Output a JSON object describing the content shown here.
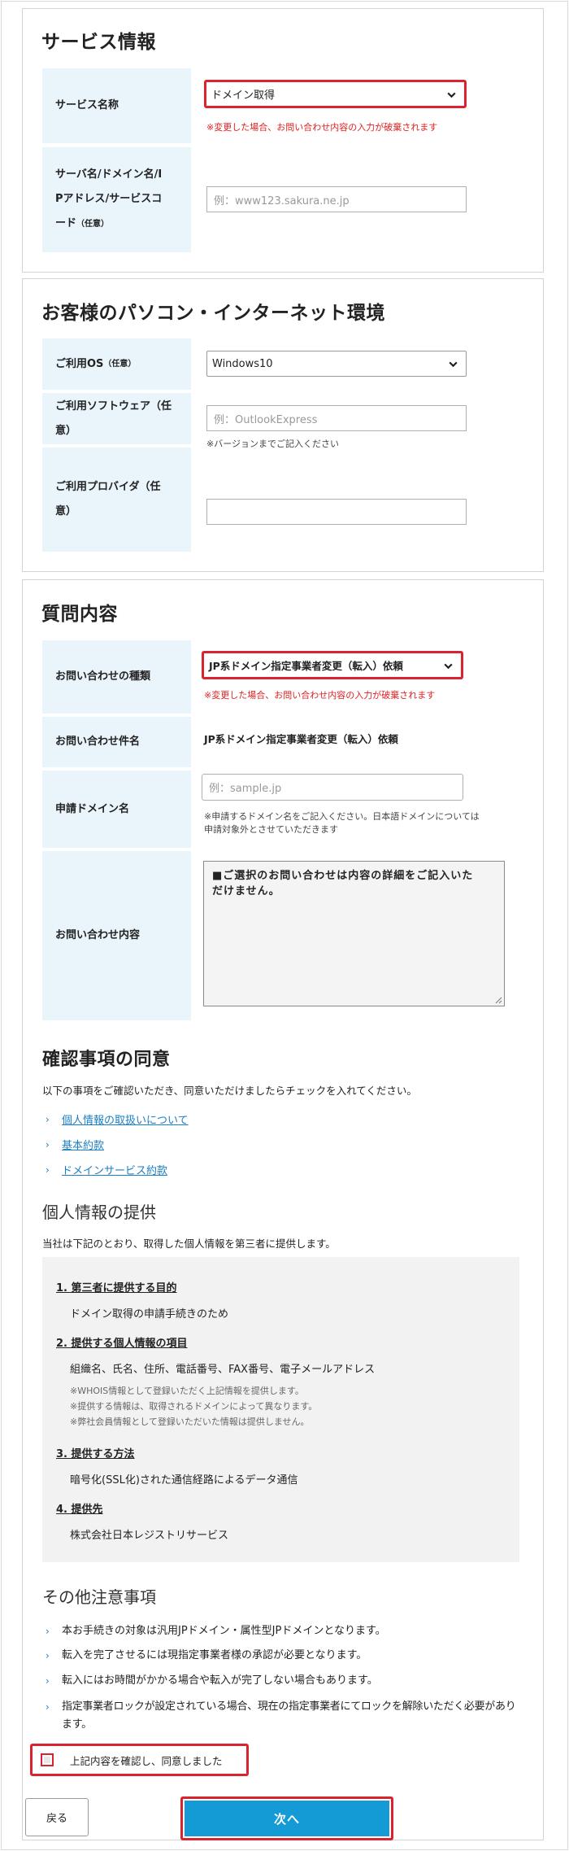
{
  "service_section": {
    "title": "サービス情報",
    "service_name_label": "サービス名称",
    "service_name_value": "ドメイン取得",
    "service_name_note": "※変更した場合、お問い合わせ内容の入力が破棄されます",
    "server_label_l1": "サーバ名/ドメイン名/I",
    "server_label_l2": "Pアドレス/サービスコ",
    "server_label_l3": "ード",
    "optional": "（任意）",
    "server_placeholder": "例：www123.sakura.ne.jp"
  },
  "env_section": {
    "title": "お客様のパソコン・インターネット環境",
    "os_label": "ご利用OS",
    "os_value": "Windows10",
    "software_label_l1": "ご利用ソフトウェア（任",
    "software_label_l2": "意）",
    "software_placeholder": "例：OutlookExpress",
    "software_note": "※バージョンまでご記入ください",
    "provider_label_l1": "ご利用プロバイダ（任",
    "provider_label_l2": "意）",
    "provider_value": ""
  },
  "inquiry_section": {
    "title": "質問内容",
    "type_label": "お問い合わせの種類",
    "type_value": "JP系ドメイン指定事業者変更（転入）依頼",
    "type_note": "※変更した場合、お問い合わせ内容の入力が破棄されます",
    "subject_label": "お問い合わせ件名",
    "subject_value": "JP系ドメイン指定事業者変更（転入）依頼",
    "domain_label": "申請ドメイン名",
    "domain_placeholder": "例：sample.jp",
    "domain_note_l1": "※申請するドメイン名をご記入ください。日本語ドメインについては",
    "domain_note_l2": "申請対象外とさせていただきます",
    "content_label": "お問い合わせ内容",
    "content_text_l1": "■ご選択のお問い合わせは内容の詳細をご記入いた",
    "content_text_l2": "だけません。"
  },
  "consent_section": {
    "title": "確認事項の同意",
    "intro": "以下の事項をご確認いただき、同意いただけましたらチェックを入れてください。",
    "links": [
      "個人情報の取扱いについて",
      "基本約款",
      "ドメインサービス約款"
    ],
    "provision_title": "個人情報の提供",
    "provision_intro": "当社は下記のとおり、取得した個人情報を第三者に提供します。",
    "provision": {
      "h1": "1. 第三者に提供する目的",
      "b1": "ドメイン取得の申請手続きのため",
      "h2": "2. 提供する個人情報の項目",
      "b2": "組織名、氏名、住所、電話番号、FAX番号、電子メールアドレス",
      "n1": "※WHOIS情報として登録いただく上記情報を提供します。",
      "n2": "※提供する情報は、取得されるドメインによって異なります。",
      "n3": "※弊社会員情報として登録いただいた情報は提供しません。",
      "h3": "3. 提供する方法",
      "b3": "暗号化(SSL化)された通信経路によるデータ通信",
      "h4": "4. 提供先",
      "b4": "株式会社日本レジストリサービス"
    },
    "notes_title": "その他注意事項",
    "notes": [
      "本お手続きの対象は汎用JPドメイン・属性型JPドメインとなります。",
      "転入を完了させるには現指定事業者様の承認が必要となります。",
      "転入にはお時間がかかる場合や転入が完了しない場合もあります。",
      "指定事業者ロックが設定されている場合、現在の指定事業者にてロックを解除いただく必要があります。"
    ],
    "agree_label": "上記内容を確認し、同意しました"
  },
  "buttons": {
    "back": "戻る",
    "next": "次へ"
  },
  "colors": {
    "label_bg": "#eaf4fb",
    "highlight_red": "#d9232f",
    "link_blue": "#1a7fc4",
    "next_button": "#149bd6",
    "note_red": "#e02020"
  }
}
